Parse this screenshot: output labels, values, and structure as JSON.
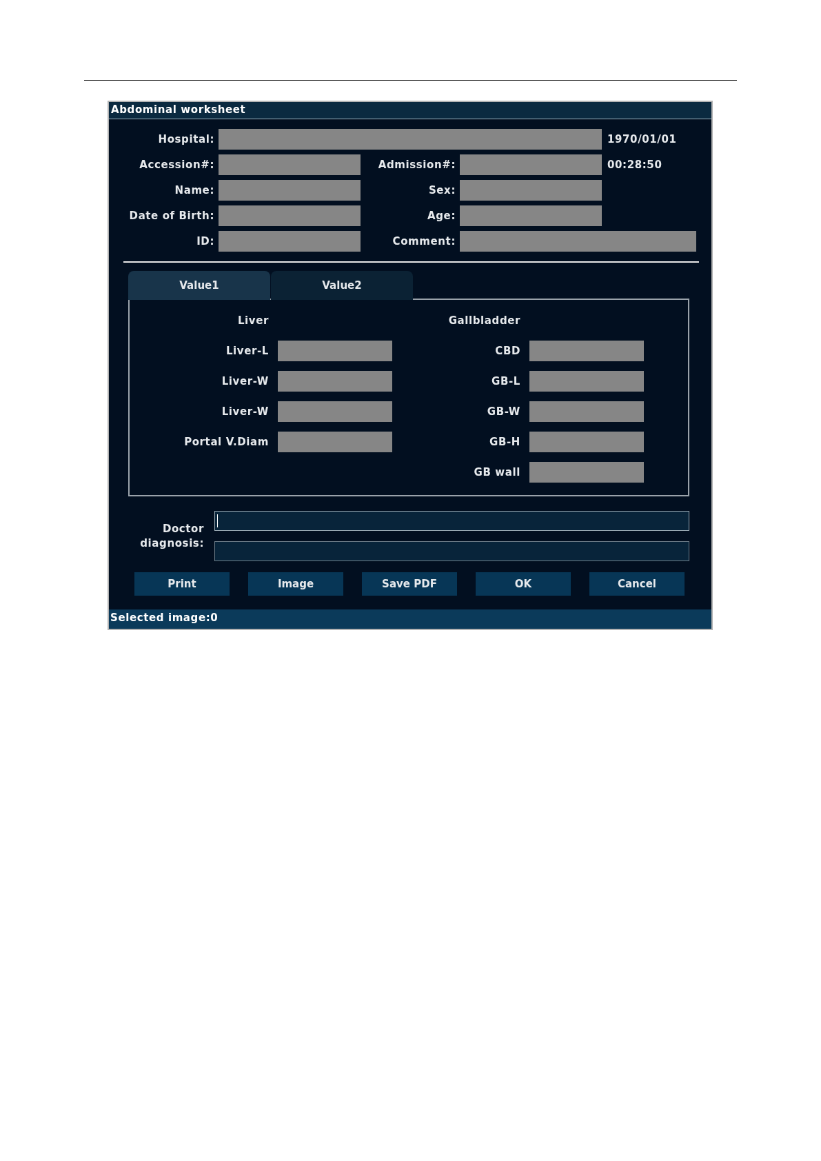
{
  "window": {
    "title": "Abdominal worksheet"
  },
  "header_rows": [
    {
      "fields": [
        {
          "label": "Hospital:",
          "kind": "wide"
        }
      ],
      "info": "1970/01/01"
    },
    {
      "fields": [
        {
          "label": "Accession#:",
          "kind": "normal"
        },
        {
          "label": "Admission#:",
          "kind": "normal"
        }
      ],
      "info": "00:28:50"
    },
    {
      "fields": [
        {
          "label": "Name:",
          "kind": "normal"
        },
        {
          "label": "Sex:",
          "kind": "normal"
        }
      ]
    },
    {
      "fields": [
        {
          "label": "Date of Birth:",
          "kind": "normal"
        },
        {
          "label": "Age:",
          "kind": "normal"
        }
      ]
    },
    {
      "fields": [
        {
          "label": "ID:",
          "kind": "normal"
        },
        {
          "label": "Comment:",
          "kind": "long"
        }
      ]
    }
  ],
  "tabs": [
    {
      "label": "Value1",
      "selected": true
    },
    {
      "label": "Value2",
      "selected": false
    }
  ],
  "groups": [
    {
      "title": "Liver",
      "items": [
        "Liver-L",
        "Liver-W",
        "Liver-W",
        "Portal V.Diam"
      ]
    },
    {
      "title": "Gallbladder",
      "items": [
        "CBD",
        "GB-L",
        "GB-W",
        "GB-H",
        "GB wall"
      ]
    }
  ],
  "diagnosis": {
    "label": "Doctor diagnosis:",
    "inputs": [
      {
        "focused": true
      },
      {
        "focused": false
      }
    ]
  },
  "buttons": [
    "Print",
    "Image",
    "Save PDF",
    "OK",
    "Cancel"
  ],
  "status_bar": "Selected image:0"
}
